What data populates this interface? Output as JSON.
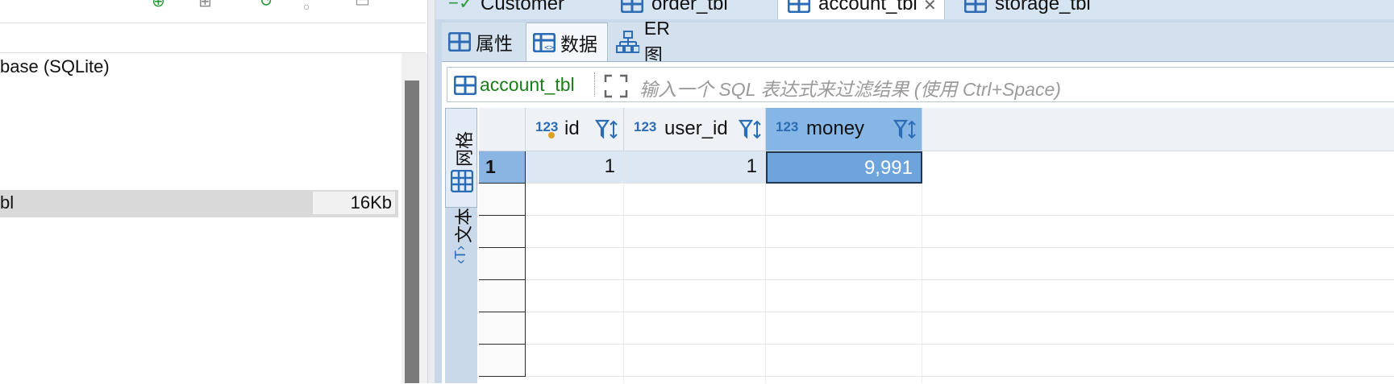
{
  "editor_tabs": [
    {
      "label": "Customer"
    },
    {
      "label": "order_tbl"
    },
    {
      "label": "account_tbl",
      "active": true
    },
    {
      "label": "storage_tbl"
    }
  ],
  "navigator": {
    "database_label": "base (SQLite)",
    "selected_item": {
      "name": "bl",
      "size": "16Kb"
    }
  },
  "sub_tabs": [
    {
      "label": "属性",
      "icon": "properties-icon"
    },
    {
      "label": "数据",
      "icon": "data-icon",
      "active": true
    },
    {
      "label": "ER 图",
      "icon": "er-diagram-icon"
    }
  ],
  "filter": {
    "table_name": "account_tbl",
    "placeholder": "输入一个 SQL 表达式来过滤结果 (使用 Ctrl+Space)"
  },
  "view_modes": [
    {
      "label": "网格",
      "icon": "grid-icon",
      "active": true
    },
    {
      "label": "文本",
      "icon": "text-icon"
    }
  ],
  "grid": {
    "columns": [
      {
        "type_label": "123",
        "name": "id"
      },
      {
        "type_label": "123",
        "name": "user_id"
      },
      {
        "type_label": "123",
        "name": "money",
        "selected": true
      }
    ],
    "rows": [
      {
        "num": "1",
        "cells": [
          "1",
          "1",
          "9,991"
        ]
      }
    ]
  },
  "colors": {
    "accent": "#2b6cb5",
    "selected_header": "#86b6e6",
    "focused_cell": "#6da4db",
    "table_name_green": "#1a7f1a"
  }
}
